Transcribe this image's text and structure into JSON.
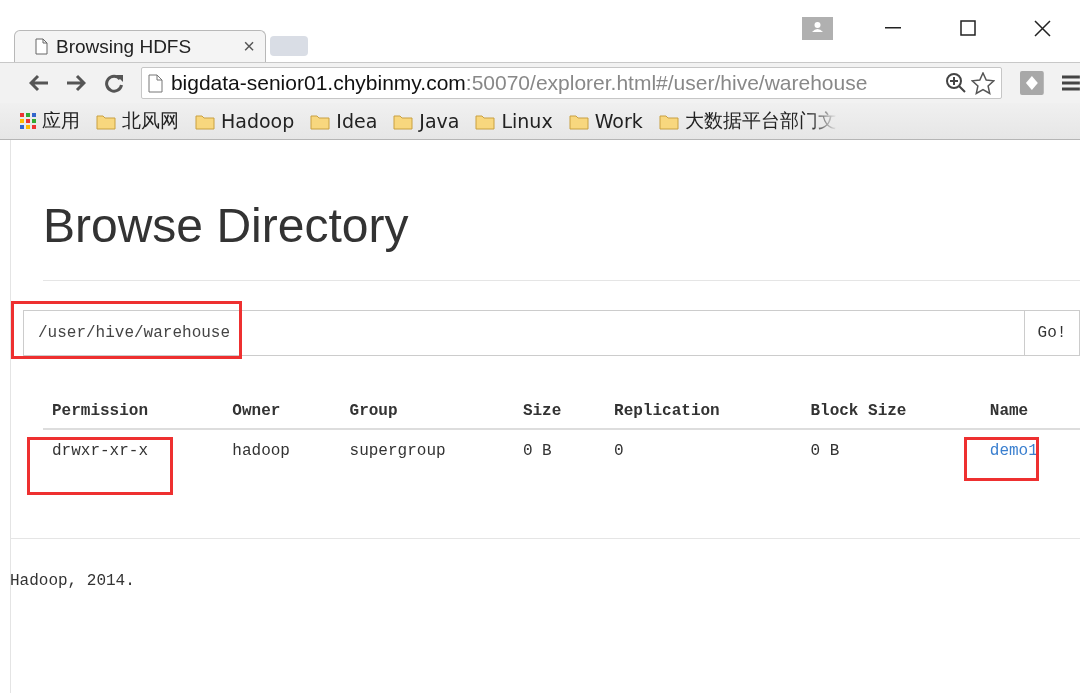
{
  "browser": {
    "tabs": [
      {
        "title": "Browsing HDFS",
        "close": "×",
        "selected": true
      }
    ],
    "address": {
      "host": "bigdata-senior01.chybinmy.com",
      "rest": ":50070/explorer.html#/user/hive/warehouse"
    },
    "bookmarks": [
      {
        "kind": "apps",
        "label": "应用"
      },
      {
        "kind": "folder",
        "label": "北风网"
      },
      {
        "kind": "folder",
        "label": "Hadoop"
      },
      {
        "kind": "folder",
        "label": "Idea"
      },
      {
        "kind": "folder",
        "label": "Java"
      },
      {
        "kind": "folder",
        "label": "Linux"
      },
      {
        "kind": "folder",
        "label": "Work"
      },
      {
        "kind": "folder",
        "label": "大数据平台部门文",
        "faded": true
      }
    ]
  },
  "page": {
    "heading": "Browse Directory",
    "path": {
      "value": "/user/hive/warehouse",
      "button": "Go!"
    },
    "table": {
      "columns": [
        "Permission",
        "Owner",
        "Group",
        "Size",
        "Replication",
        "Block Size",
        "Name"
      ],
      "rows": [
        {
          "cells": [
            "drwxr-xr-x",
            "hadoop",
            "supergroup",
            "0 B",
            "0",
            "0 B",
            "demo1"
          ]
        }
      ]
    },
    "footer": "Hadoop, 2014."
  }
}
